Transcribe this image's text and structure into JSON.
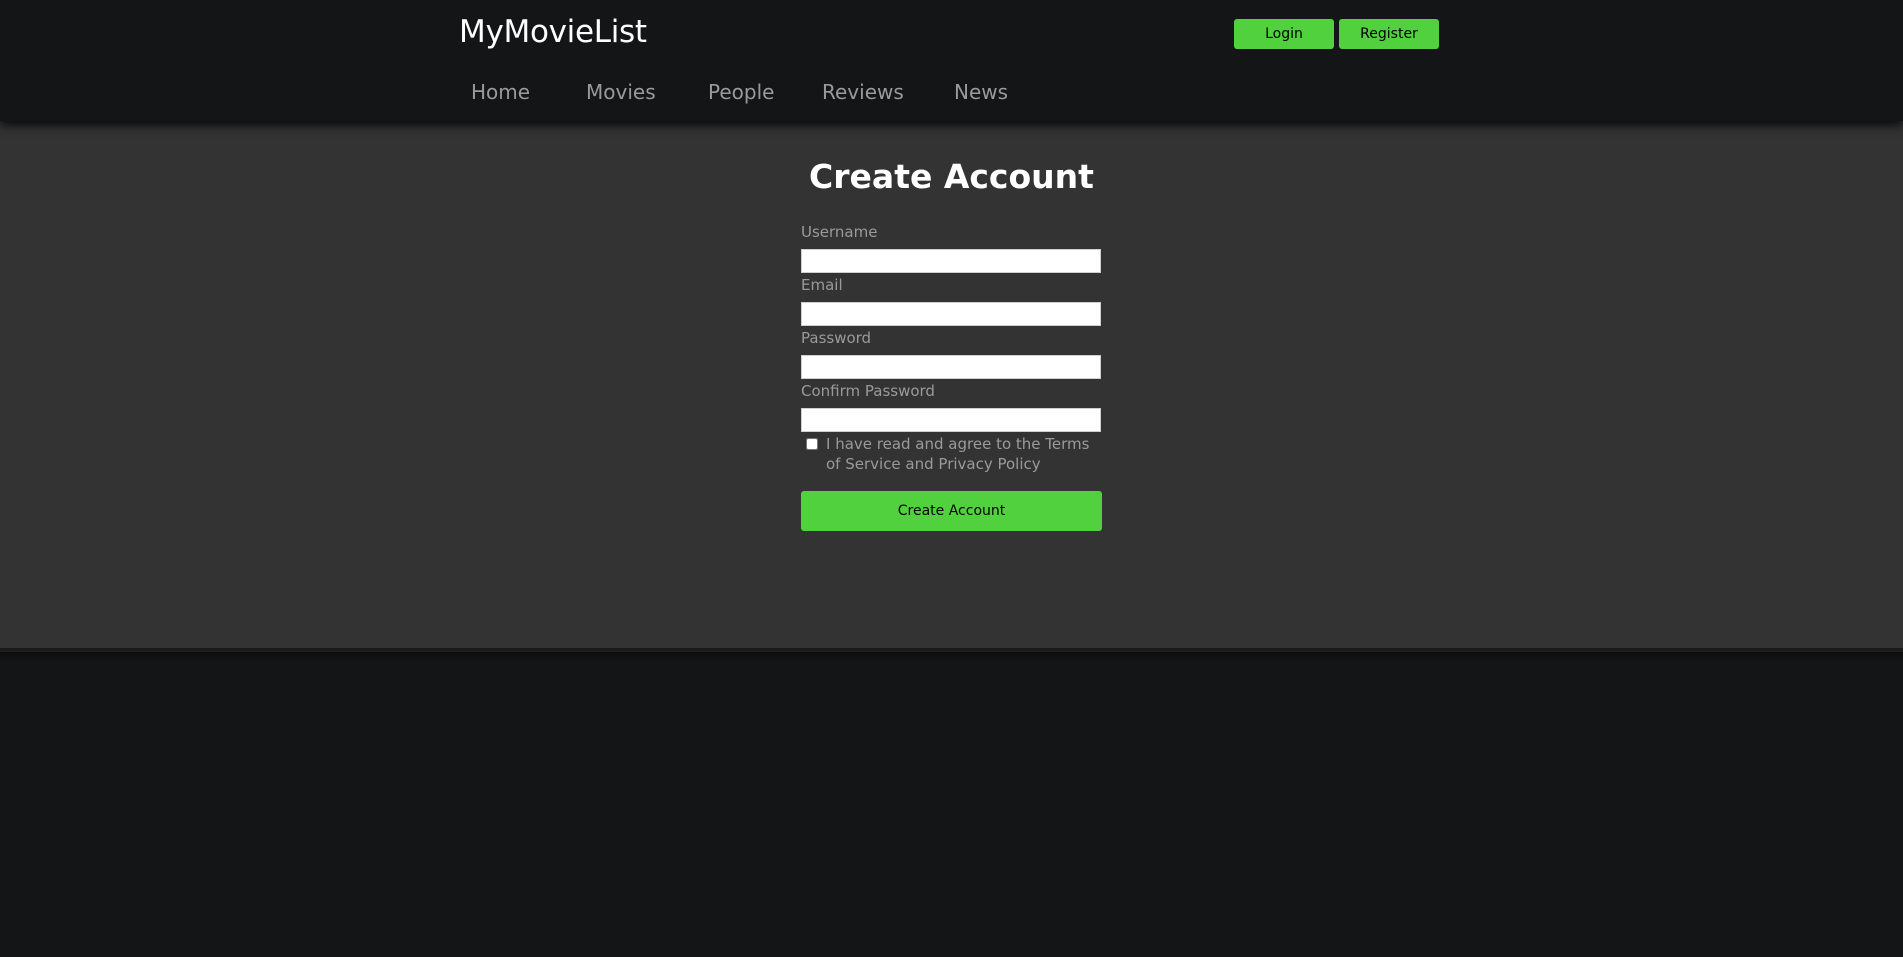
{
  "header": {
    "site_title": "MyMovieList",
    "login_label": "Login",
    "register_label": "Register"
  },
  "nav": {
    "items": [
      {
        "label": "Home"
      },
      {
        "label": "Movies"
      },
      {
        "label": "People"
      },
      {
        "label": "Reviews"
      },
      {
        "label": "News"
      }
    ]
  },
  "form": {
    "title": "Create Account",
    "fields": [
      {
        "label": "Username",
        "value": ""
      },
      {
        "label": "Email",
        "value": ""
      },
      {
        "label": "Password",
        "value": ""
      },
      {
        "label": "Confirm Password",
        "value": ""
      }
    ],
    "terms_label": "I have read and agree to the Terms of Service and Privacy Policy",
    "terms_checked": false,
    "submit_label": "Create Account"
  },
  "colors": {
    "accent": "#52d13f",
    "header_bg": "#141516",
    "main_bg": "#333333",
    "text_muted": "#9a9a9a"
  }
}
